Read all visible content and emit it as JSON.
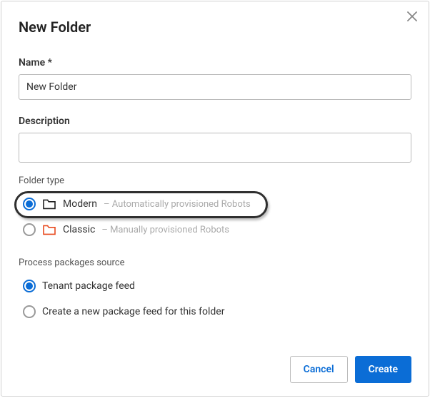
{
  "dialog": {
    "title": "New Folder",
    "fields": {
      "name_label": "Name *",
      "name_value": "New Folder",
      "description_label": "Description",
      "description_value": ""
    },
    "folder_type": {
      "section_label": "Folder type",
      "options": [
        {
          "label": "Modern",
          "hint": "– Automatically provisioned Robots",
          "selected": true
        },
        {
          "label": "Classic",
          "hint": "– Manually provisioned Robots",
          "selected": false
        }
      ]
    },
    "packages": {
      "section_label": "Process packages source",
      "options": [
        {
          "label": "Tenant package feed",
          "selected": true
        },
        {
          "label": "Create a new package feed for this folder",
          "selected": false
        }
      ]
    },
    "buttons": {
      "cancel": "Cancel",
      "create": "Create"
    }
  }
}
